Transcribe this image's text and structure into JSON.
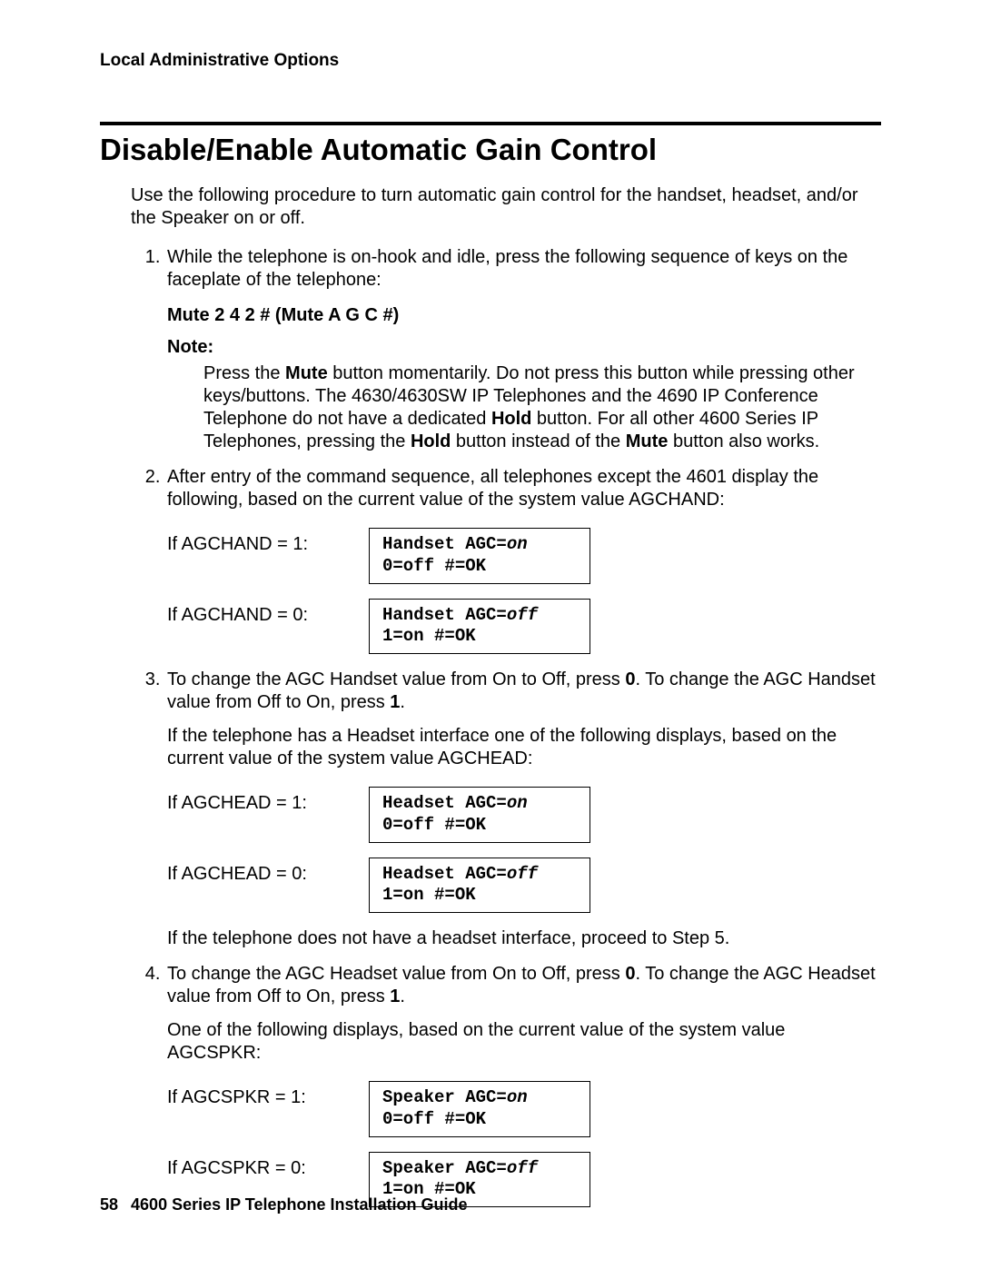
{
  "header": {
    "running": "Local Administrative Options"
  },
  "title": "Disable/Enable Automatic Gain Control",
  "intro": "Use the following procedure to turn automatic gain control for the handset, headset, and/or the Speaker on or off.",
  "step1": {
    "text": "While the telephone is on-hook and idle, press the following sequence of keys on the faceplate of the telephone:",
    "keyseq": "Mute 2 4 2 # (Mute A G C #)",
    "note_label": "Note:",
    "note_pre": "Press the ",
    "note_mute": "Mute",
    "note_mid1": " button momentarily. Do not press this button while pressing other keys/buttons. The 4630/4630SW IP Telephones and the 4690 IP Conference Telephone do not have a dedicated ",
    "note_hold": "Hold",
    "note_mid2": " button. For all other 4600 Series IP Telephones, pressing the ",
    "note_hold2": "Hold",
    "note_mid3": " button instead of the ",
    "note_mute2": "Mute",
    "note_end": " button also works."
  },
  "step2": {
    "text": "After entry of the command sequence, all telephones except the 4601 display the following, based on the current value of the system value AGCHAND:",
    "rows": [
      {
        "label": "If AGCHAND = 1:",
        "line1a": "Handset AGC=",
        "line1b": "on",
        "line2": "0=off #=OK"
      },
      {
        "label": "If AGCHAND = 0:",
        "line1a": "Handset AGC=",
        "line1b": "off",
        "line2": "1=on #=OK"
      }
    ]
  },
  "step3": {
    "p1a": "To change the AGC Handset value from On to Off, press ",
    "p1b": "0",
    "p1c": ". To change the AGC Handset value from Off to On, press ",
    "p1d": "1",
    "p1e": ".",
    "p2": "If the telephone has a Headset interface one of the following displays, based on the current value of the system value AGCHEAD:",
    "rows": [
      {
        "label": "If AGCHEAD = 1:",
        "line1a": "Headset AGC=",
        "line1b": "on",
        "line2": "0=off #=OK"
      },
      {
        "label": "If AGCHEAD = 0:",
        "line1a": "Headset AGC=",
        "line1b": "off",
        "line2": "1=on #=OK"
      }
    ],
    "p3": "If the telephone does not have a headset interface, proceed to Step 5."
  },
  "step4": {
    "p1a": "To change the AGC Headset value from On to Off, press ",
    "p1b": "0",
    "p1c": ". To change the AGC Headset value from Off to On, press ",
    "p1d": "1",
    "p1e": ".",
    "p2": "One of the following displays, based on the current value of the system value AGCSPKR:",
    "rows": [
      {
        "label": "If AGCSPKR = 1:",
        "line1a": "Speaker AGC=",
        "line1b": "on",
        "line2": "0=off #=OK"
      },
      {
        "label": "If AGCSPKR = 0:",
        "line1a": "Speaker AGC=",
        "line1b": "off",
        "line2": "1=on #=OK"
      }
    ]
  },
  "footer": {
    "page": "58",
    "title": "4600 Series IP Telephone Installation Guide"
  }
}
